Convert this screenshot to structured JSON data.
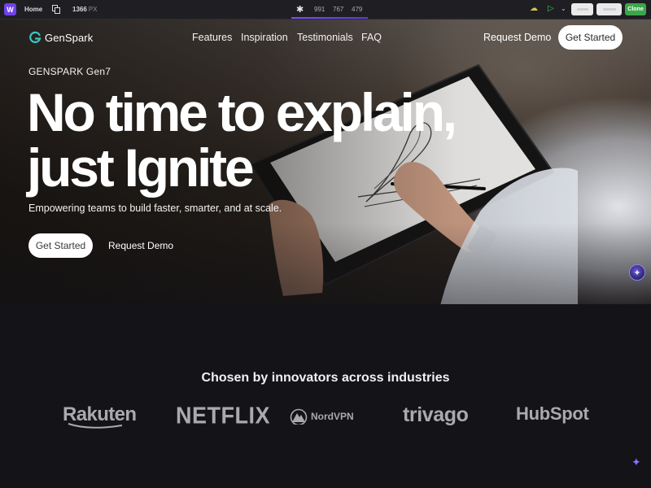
{
  "editor": {
    "logo_letter": "W",
    "home_label": "Home",
    "width_value": "1366",
    "width_unit": "PX",
    "breakpoints": [
      "991",
      "767",
      "479"
    ],
    "clone_label": "Clone",
    "accent": "#6f42e8",
    "clone_color": "#3aa84a"
  },
  "nav": {
    "brand": "GenSpark",
    "links": [
      "Features",
      "Inspiration",
      "Testimonials",
      "FAQ"
    ],
    "request_demo": "Request Demo",
    "cta": "Get Started"
  },
  "hero": {
    "eyebrow": "GENSPARK Gen7",
    "headline_line1": "No time to explain,",
    "headline_line2": "just Ignite",
    "subline": "Empowering teams to build faster, smarter, and at scale.",
    "primary_cta": "Get Started",
    "secondary_cta": "Request Demo"
  },
  "logos": {
    "title": "Chosen by innovators across industries",
    "items": [
      "Rakuten",
      "NETFLIX",
      "NordVPN",
      "trivago",
      "HubSpot"
    ]
  },
  "icons": {
    "badge": "sparkle-badge-icon",
    "corner": "sparkle-icon"
  }
}
